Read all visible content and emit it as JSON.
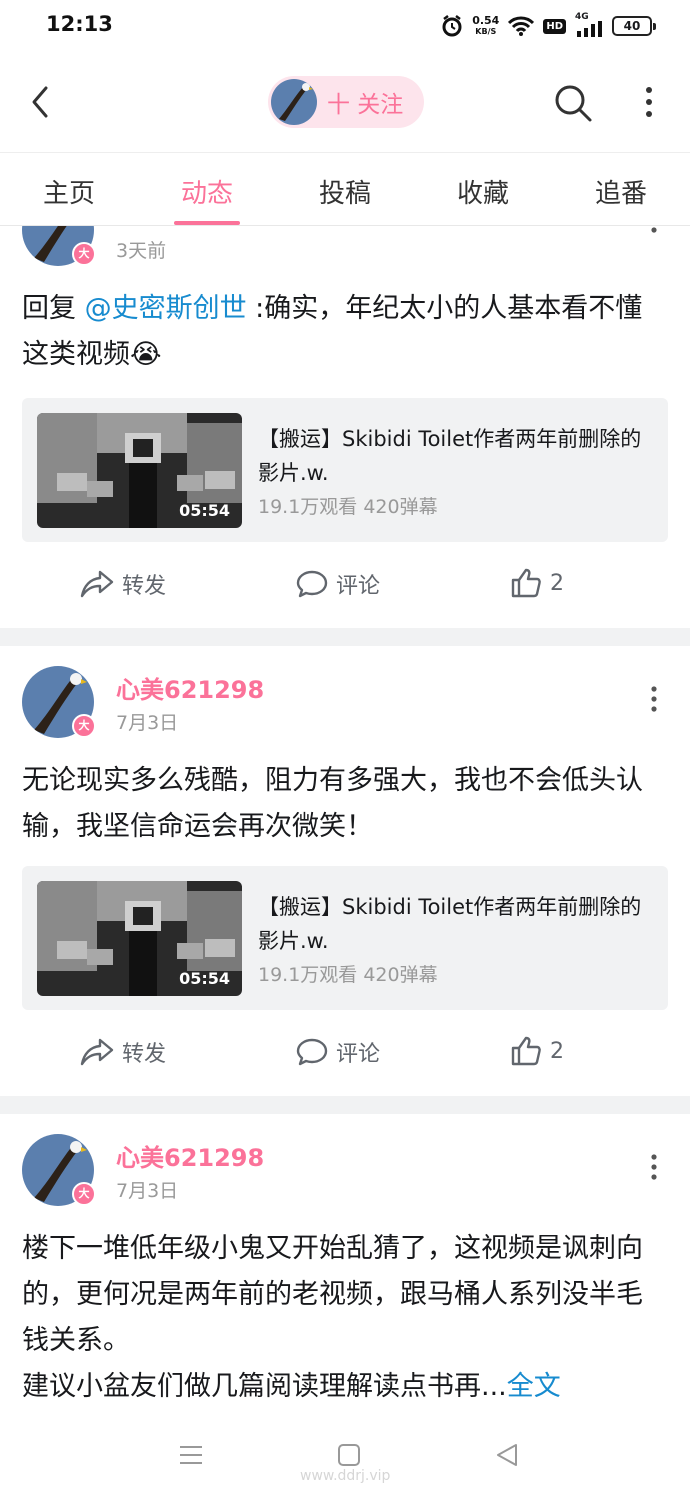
{
  "status_bar": {
    "time": "12:13",
    "speed_value": "0.54",
    "speed_unit": "KB/S",
    "network": "4G",
    "hd": "HD",
    "battery": "40"
  },
  "header": {
    "follow_label": "十 关注"
  },
  "tabs": [
    {
      "label": "主页",
      "active": false
    },
    {
      "label": "动态",
      "active": true
    },
    {
      "label": "投稿",
      "active": false
    },
    {
      "label": "收藏",
      "active": false
    },
    {
      "label": "追番",
      "active": false
    }
  ],
  "posts": [
    {
      "time": "3天前",
      "text_prefix": "回复 ",
      "mention": "@史密斯创世",
      "text": " :确实，年纪太小的人基本看不懂这类视频",
      "emoji": "😭",
      "video": {
        "title": "【搬运】Skibidi Toilet作者两年前删除的影片.w.",
        "duration": "05:54",
        "stats": "19.1万观看 420弹幕"
      },
      "actions": {
        "share": "转发",
        "comment": "评论",
        "likes": "2"
      }
    },
    {
      "username": "心美621298",
      "time": "7月3日",
      "text": "无论现实多么残酷，阻力有多强大，我也不会低头认输，我坚信命运会再次微笑！",
      "video": {
        "title": "【搬运】Skibidi Toilet作者两年前删除的影片.w.",
        "duration": "05:54",
        "stats": "19.1万观看 420弹幕"
      },
      "actions": {
        "share": "转发",
        "comment": "评论",
        "likes": "2"
      }
    },
    {
      "username": "心美621298",
      "time": "7月3日",
      "text": "楼下一堆低年级小鬼又开始乱猜了，这视频是讽刺向的，更何况是两年前的老视频，跟马桶人系列没半毛钱关系。",
      "text2": "建议小盆友们做几篇阅读理解读点书再...",
      "more_link": "全文"
    }
  ],
  "avatar_badge": "大",
  "watermark": "www.ddrj.vip"
}
